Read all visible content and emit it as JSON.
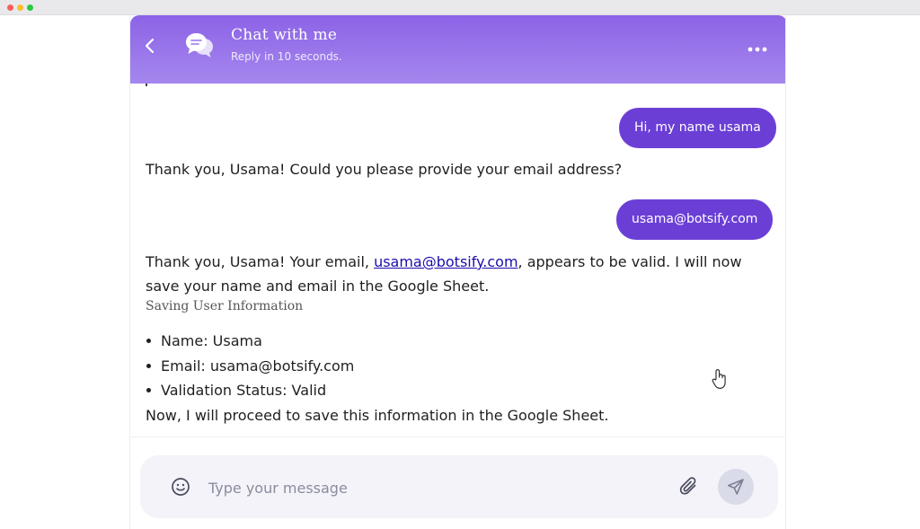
{
  "window": {
    "controls": [
      "close",
      "minimize",
      "maximize"
    ]
  },
  "header": {
    "title": "Chat with me",
    "subtitle": "Reply in 10 seconds.",
    "back_icon": "chevron-left-icon",
    "avatar_icon": "chat-bubbles-icon",
    "menu_icon": "more-dots-icon"
  },
  "messages": {
    "user_1": "Hi, my name usama",
    "bot_1": "Thank you, Usama! Could you please provide your email address?",
    "user_2": "usama@botsify.com",
    "bot_2": {
      "before_link": "Thank you, Usama! Your email, ",
      "link_text": "usama@botsify.com",
      "after_link": ", appears to be valid. I will now save your name and email in the Google Sheet."
    },
    "section_label": "Saving User Information",
    "list_items": [
      "Name: Usama",
      "Email: usama@botsify.com",
      "Validation Status: Valid"
    ],
    "bot_3": "Now, I will proceed to save this information in the Google Sheet."
  },
  "composer": {
    "placeholder": "Type your message",
    "emoji_icon": "smiley-icon",
    "attach_icon": "paperclip-icon",
    "send_icon": "paper-plane-icon"
  },
  "colors": {
    "header_gradient_top": "#8c63e6",
    "header_gradient_bottom": "#a587ee",
    "user_bubble": "#6b3fd6",
    "link": "#1a0dab",
    "composer_bg": "#f3f3f9",
    "send_button_bg": "#d9dbe8"
  }
}
